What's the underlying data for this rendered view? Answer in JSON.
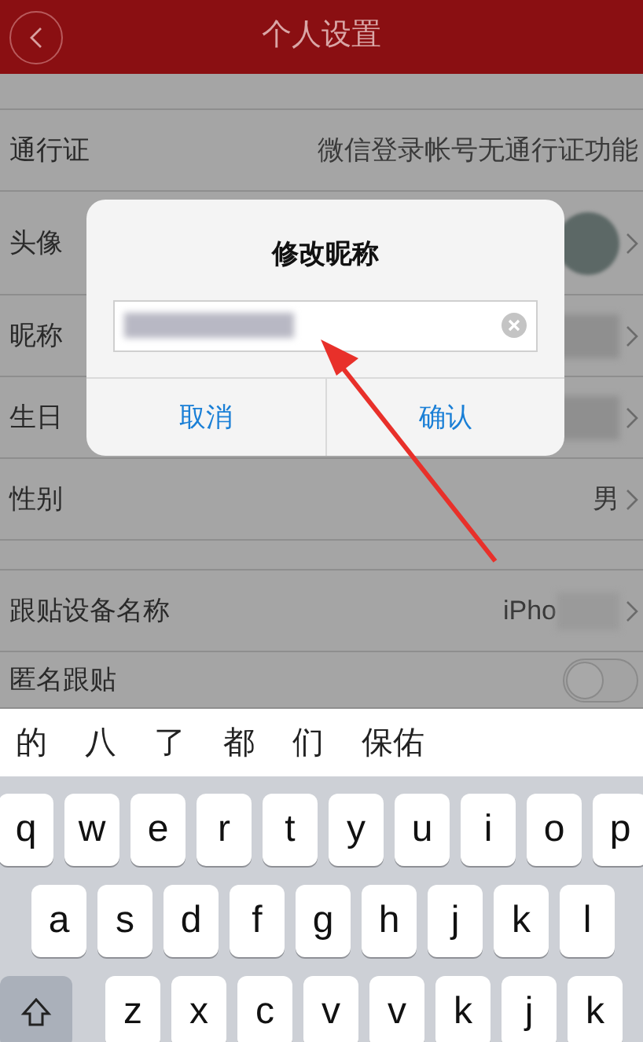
{
  "header": {
    "title": "个人设置"
  },
  "sections": [
    [
      {
        "kind": "text",
        "label": "通行证",
        "value": "微信登录帐号无通行证功能",
        "chevron": false
      },
      {
        "kind": "avatar",
        "label": "头像",
        "chevron": true
      },
      {
        "kind": "redacted",
        "label": "昵称",
        "chevron": true
      },
      {
        "kind": "redacted",
        "label": "生日",
        "chevron": true
      },
      {
        "kind": "text",
        "label": "性别",
        "value": "男",
        "chevron": true
      }
    ],
    [
      {
        "kind": "partial",
        "label": "跟贴设备名称",
        "value": "iPho",
        "chevron": true
      },
      {
        "kind": "toggle",
        "label": "匿名跟贴",
        "on": false
      }
    ]
  ],
  "dialog": {
    "title": "修改昵称",
    "buttons": [
      "取消",
      "确认"
    ]
  },
  "keyboard": {
    "candidates": [
      "的",
      "八",
      "了",
      "都",
      "们",
      "保佑"
    ],
    "rows": [
      [
        "q",
        "w",
        "e",
        "r",
        "t",
        "y",
        "u",
        "i",
        "o",
        "p"
      ],
      [
        "a",
        "s",
        "d",
        "f",
        "g",
        "h",
        "j",
        "k",
        "l"
      ],
      [
        "z",
        "x",
        "c",
        "v",
        "v",
        "k",
        "j",
        "k"
      ]
    ]
  }
}
